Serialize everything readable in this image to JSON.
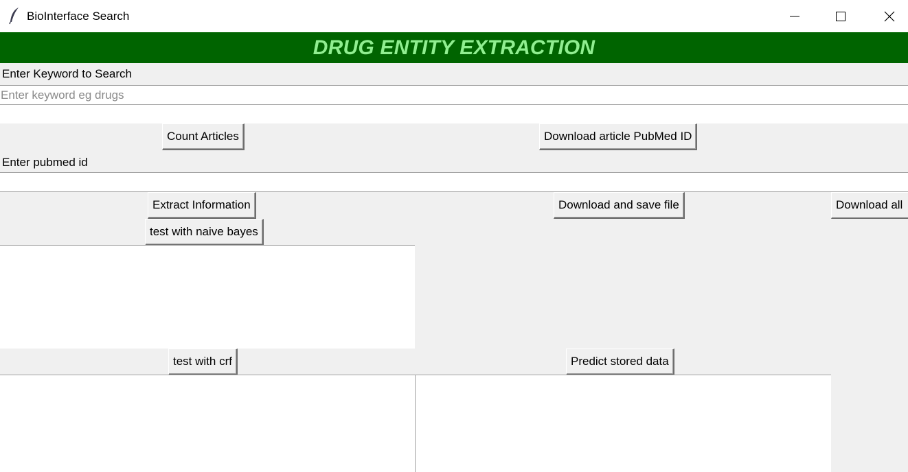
{
  "window": {
    "title": "BioInterface Search",
    "icon": "feather-icon",
    "controls": {
      "minimize": "minimize-icon",
      "maximize": "maximize-icon",
      "close": "close-icon"
    }
  },
  "banner": {
    "title": "DRUG ENTITY EXTRACTION",
    "bg_color": "#006400",
    "text_color": "#90ee90"
  },
  "keyword": {
    "label": "Enter Keyword to Search",
    "placeholder": "Enter keyword eg drugs",
    "value": ""
  },
  "buttons": {
    "count_articles": "Count Articles",
    "download_pubmed_id": "Download article PubMed ID",
    "extract_information": "Extract Information",
    "download_save_file": "Download and save file",
    "download_all": "Download all",
    "test_naive_bayes": "test with naive bayes",
    "test_crf": "test with crf",
    "predict_stored": "Predict stored data"
  },
  "pubmed": {
    "label": "Enter pubmed id",
    "value": ""
  },
  "outputs": {
    "naive_bayes": "",
    "crf": "",
    "predict": ""
  }
}
